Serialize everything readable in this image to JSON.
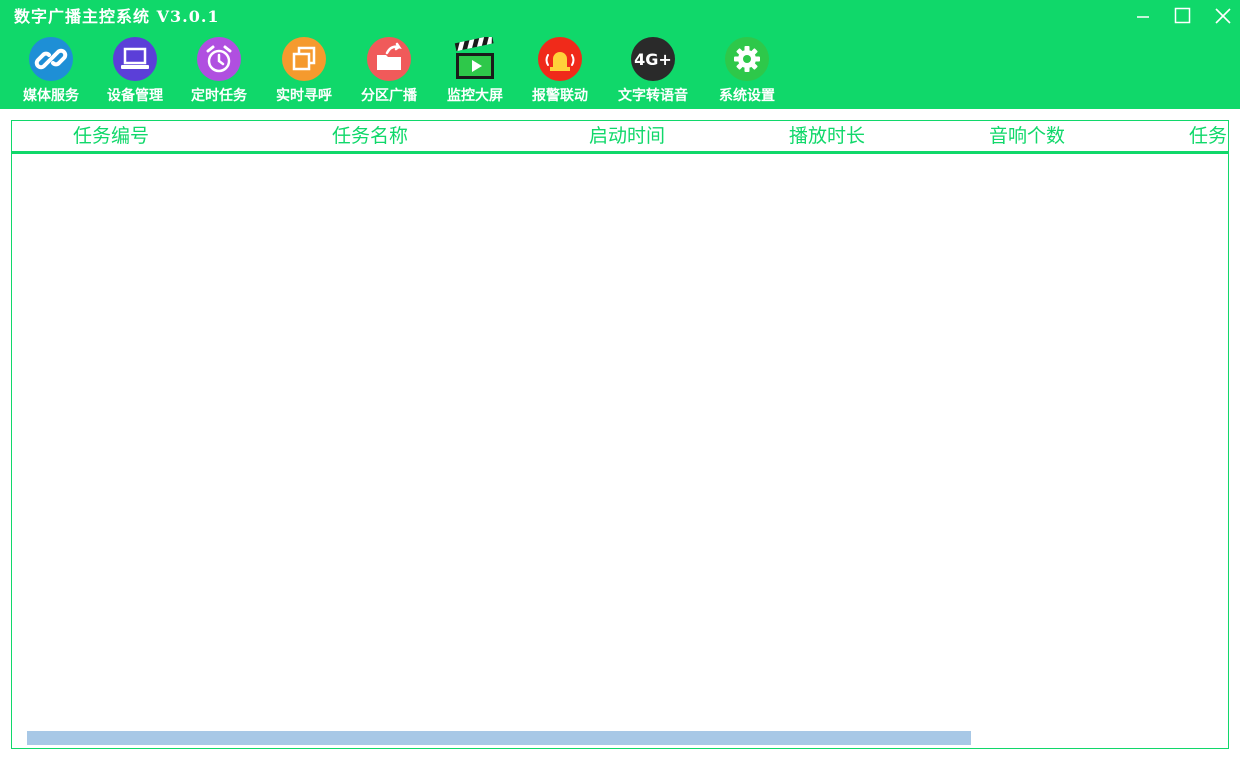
{
  "window": {
    "title": "数字广播主控系统 V3.0.1"
  },
  "toolbar": {
    "items": [
      {
        "label": "媒体服务",
        "icon": "link-icon",
        "color": "#1e8fd6"
      },
      {
        "label": "设备管理",
        "icon": "laptop-icon",
        "color": "#5b3fd8"
      },
      {
        "label": "定时任务",
        "icon": "alarm-clock-icon",
        "color": "#b04fe0"
      },
      {
        "label": "实时寻呼",
        "icon": "copy-window-icon",
        "color": "#f59a2e"
      },
      {
        "label": "分区广播",
        "icon": "folder-share-icon",
        "color": "#f05a5a"
      },
      {
        "label": "监控大屏",
        "icon": "clapperboard-icon",
        "color": "#1a1a1a"
      },
      {
        "label": "报警联动",
        "icon": "alarm-bell-icon",
        "color": "#f02a1a"
      },
      {
        "label": "文字转语音",
        "icon": "4g-plus-icon",
        "color": "#2a2a2a"
      },
      {
        "label": "系统设置",
        "icon": "gear-icon",
        "color": "#2ec84a"
      }
    ]
  },
  "table": {
    "columns": [
      "任务编号",
      "任务名称",
      "启动时间",
      "播放时长",
      "音响个数",
      "任务"
    ],
    "rows": []
  },
  "colors": {
    "header_bg": "#10d86a",
    "accent": "#10d86a",
    "scrollbar": "#a8c8e6"
  }
}
